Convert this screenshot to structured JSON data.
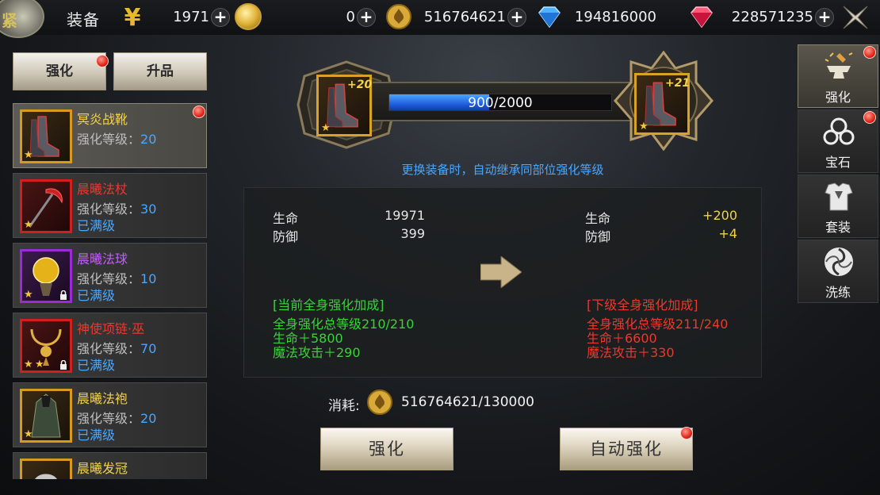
{
  "header": {
    "emblem_char": "紧",
    "title": "装备",
    "currencies": [
      {
        "icon": "yen-icon",
        "amount": "1971"
      },
      {
        "icon": "gold-coin-icon",
        "amount": "0"
      },
      {
        "icon": "fleur-coin-icon",
        "amount": "516764621"
      },
      {
        "icon": "blue-diamond-icon",
        "amount": "194816000"
      },
      {
        "icon": "red-gem-icon",
        "amount": "228571235"
      }
    ],
    "plus": "+"
  },
  "left_tabs": {
    "strengthen": "强化",
    "upgrade": "升品"
  },
  "equipment": [
    {
      "name": "冥炎战靴",
      "level_label": "强化等级：",
      "level": "20",
      "maxed": "",
      "rarity": "gold",
      "name_color": "#f3d24a"
    },
    {
      "name": "晨曦法杖",
      "level_label": "强化等级：",
      "level": "30",
      "maxed": "已满级",
      "rarity": "red",
      "name_color": "#e83a2e"
    },
    {
      "name": "晨曦法球",
      "level_label": "强化等级：",
      "level": "10",
      "maxed": "已满级",
      "rarity": "purple",
      "name_color": "#c35cff"
    },
    {
      "name": "神使项链·巫",
      "level_label": "强化等级：",
      "level": "70",
      "maxed": "已满级",
      "rarity": "red",
      "name_color": "#e83a2e"
    },
    {
      "name": "晨曦法袍",
      "level_label": "强化等级：",
      "level": "20",
      "maxed": "已满级",
      "rarity": "gold",
      "name_color": "#f3d24a"
    },
    {
      "name": "晨曦发冠",
      "level_label": "",
      "level": "",
      "maxed": "",
      "rarity": "gold",
      "name_color": "#f3d24a"
    }
  ],
  "upgrade": {
    "current_level": "+20",
    "next_level": "+21",
    "progress_current": "900",
    "progress_max": "/2000",
    "progress_fraction": 0.45,
    "hint": "更换装备时，自动继承同部位强化等级"
  },
  "stats": {
    "hp_label": "生命",
    "def_label": "防御",
    "hp_value": "19971",
    "def_value": "399",
    "hp_gain": "+200",
    "def_gain": "+4",
    "current_bonus_title": "[当前全身强化加成]",
    "current_total": "全身强化总等级210/210",
    "current_hp": "生命＋5800",
    "current_matk": "魔法攻击＋290",
    "next_bonus_title": "[下级全身强化加成]",
    "next_total": "全身强化总等级211/240",
    "next_hp": "生命＋6600",
    "next_matk": "魔法攻击＋330"
  },
  "cost": {
    "label": "消耗:",
    "value": "516764621/130000"
  },
  "buttons": {
    "strengthen": "强化",
    "auto_strengthen": "自动强化"
  },
  "right_tabs": [
    {
      "label": "强化",
      "icon": "anvil-icon"
    },
    {
      "label": "宝石",
      "icon": "gem-icon"
    },
    {
      "label": "套装",
      "icon": "armor-icon"
    },
    {
      "label": "洗练",
      "icon": "swirl-icon"
    }
  ],
  "colors": {
    "accent_blue": "#4aa7ff",
    "bonus_green": "#38d338",
    "bonus_red": "#e83a2e",
    "gain_yellow": "#f3d24a"
  }
}
